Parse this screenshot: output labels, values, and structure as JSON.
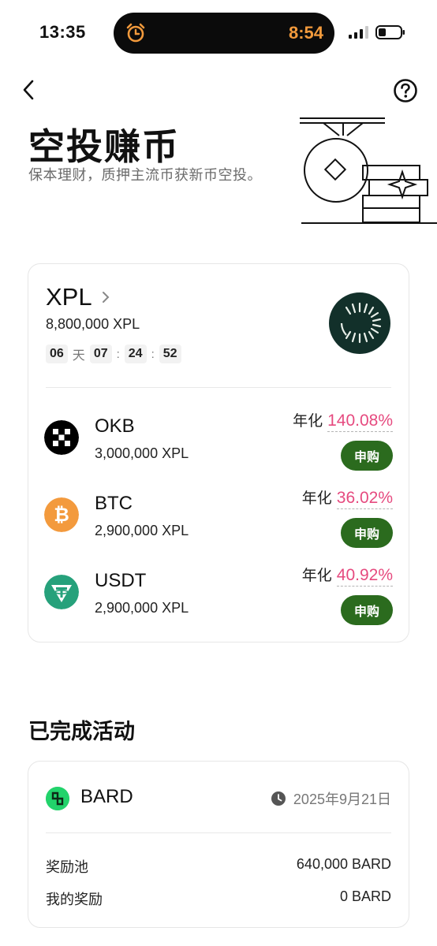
{
  "status_bar": {
    "time": "13:35",
    "island_time": "8:54"
  },
  "header": {
    "title": "空投赚币",
    "subtitle": "保本理财，质押主流币获新币空投。"
  },
  "campaign": {
    "token": "XPL",
    "total": "8,800,000 XPL",
    "countdown": {
      "days": "06",
      "day_unit": "天",
      "hours": "07",
      "minutes": "24",
      "seconds": "52"
    },
    "pools": [
      {
        "name": "OKB",
        "amount": "3,000,000 XPL",
        "apr_label": "年化",
        "apr": "140.08%",
        "button": "申购",
        "icon": "okb-icon",
        "color": "#000000"
      },
      {
        "name": "BTC",
        "amount": "2,900,000 XPL",
        "apr_label": "年化",
        "apr": "36.02%",
        "button": "申购",
        "icon": "bitcoin-icon",
        "color": "#f39a3d"
      },
      {
        "name": "USDT",
        "amount": "2,900,000 XPL",
        "apr_label": "年化",
        "apr": "40.92%",
        "button": "申购",
        "icon": "tether-icon",
        "color": "#26a17b"
      }
    ]
  },
  "completed": {
    "section_title": "已完成活动",
    "item": {
      "name": "BARD",
      "date": "2025年9月21日",
      "reward_pool_label": "奖励池",
      "reward_pool_value": "640,000 BARD",
      "my_reward_label": "我的奖励",
      "my_reward_value": "0 BARD"
    }
  },
  "colors": {
    "accent_green": "#2b6b1e",
    "apr_pink": "#e64a7f",
    "island_orange": "#f29a3c"
  }
}
